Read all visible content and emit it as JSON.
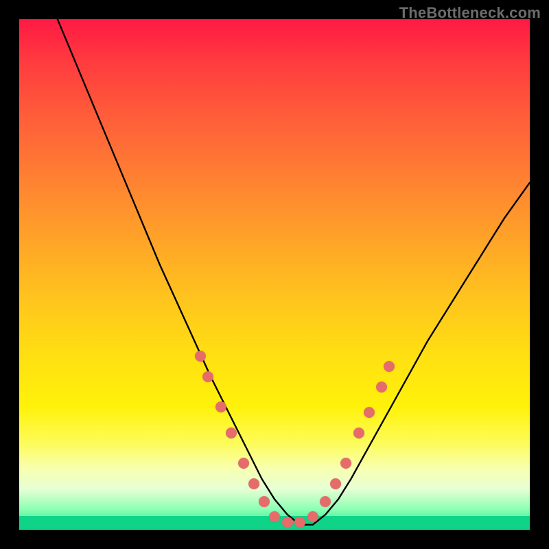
{
  "watermark": {
    "text": "TheBottleneck.com"
  },
  "chart_data": {
    "type": "line",
    "title": "",
    "xlabel": "",
    "ylabel": "",
    "xlim": [
      0,
      100
    ],
    "ylim": [
      0,
      100
    ],
    "grid": false,
    "legend": false,
    "series": [
      {
        "name": "curve",
        "stroke": "#000000",
        "x": [
          7.5,
          10,
          12.5,
          15,
          17.5,
          20,
          22.5,
          25,
          27.5,
          30,
          32.5,
          35,
          37.5,
          40,
          42.5,
          45,
          47.5,
          50,
          52.5,
          55,
          57.5,
          60,
          62.5,
          65,
          67.5,
          70,
          72.5,
          75,
          77.5,
          80,
          82.5,
          85,
          87.5,
          90,
          92.5,
          95,
          97.5,
          100
        ],
        "y": [
          100,
          94,
          88,
          82,
          76,
          70,
          64,
          58,
          52,
          46.5,
          41,
          35.5,
          30,
          25,
          20,
          15,
          10,
          6,
          3,
          1,
          1,
          3,
          6,
          10,
          14.5,
          19,
          23.5,
          28,
          32.5,
          37,
          41,
          45,
          49,
          53,
          57,
          61,
          64.5,
          68
        ]
      }
    ],
    "markers": {
      "name": "sample-points",
      "color": "#e66b6b",
      "points": [
        {
          "x": 35.5,
          "y": 34
        },
        {
          "x": 37.0,
          "y": 30
        },
        {
          "x": 39.5,
          "y": 24
        },
        {
          "x": 41.5,
          "y": 19
        },
        {
          "x": 44.0,
          "y": 13
        },
        {
          "x": 46.0,
          "y": 9
        },
        {
          "x": 48.0,
          "y": 5.5
        },
        {
          "x": 50.0,
          "y": 2.5
        },
        {
          "x": 52.5,
          "y": 1.5
        },
        {
          "x": 55.0,
          "y": 1.5
        },
        {
          "x": 57.5,
          "y": 2.5
        },
        {
          "x": 60.0,
          "y": 5.5
        },
        {
          "x": 62.0,
          "y": 9
        },
        {
          "x": 64.0,
          "y": 13
        },
        {
          "x": 66.5,
          "y": 19
        },
        {
          "x": 68.5,
          "y": 23
        },
        {
          "x": 71.0,
          "y": 28
        },
        {
          "x": 72.5,
          "y": 32
        }
      ]
    },
    "background_gradient": {
      "top": "#ff1a44",
      "mid": "#ffe012",
      "bottom": "#16e58a"
    }
  }
}
